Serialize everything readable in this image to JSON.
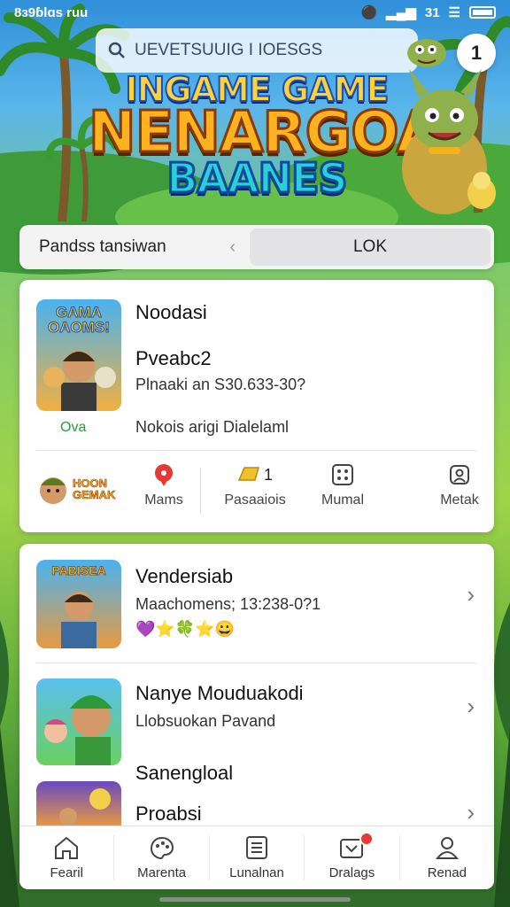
{
  "status": {
    "time": "8ɜ9ɓlɑs ruu",
    "right": "31"
  },
  "search": {
    "placeholder": "UEVETSUUIG I IOESGS"
  },
  "profile": {
    "label": "1"
  },
  "logo": {
    "line1": "INGAME GAME",
    "line2": "NENARGOA",
    "line3": "BAANES"
  },
  "tabs": {
    "left": "Pandss tansiwan",
    "right": "LOK"
  },
  "featured": {
    "thumb_text": "GAMA OAOMS!",
    "status": "Ova",
    "title": "Noodasi",
    "subtitle": "Pveabc2",
    "detail": "Plnaaki an S30.633-30?",
    "footer": "Nokois arigi Dialelaml"
  },
  "stats": {
    "badge_text": "HOON GEMAK",
    "items": [
      {
        "label": "Mams",
        "value": ""
      },
      {
        "label": "Pasaaiois",
        "value": "1"
      },
      {
        "label": "Mumal",
        "value": ""
      },
      {
        "label": "Metak",
        "value": ""
      }
    ]
  },
  "list": [
    {
      "title": "Vendersiab",
      "subtitle": "Maachomens; 13:238-0?1",
      "thumb_text": "PABISEA"
    },
    {
      "title": "Nanye Mouduakodi",
      "subtitle": "Llobsuokan Pavand"
    },
    {
      "title": "Sanengloal",
      "subtitle": "Proabsi"
    }
  ],
  "nav": [
    {
      "label": "Fearil"
    },
    {
      "label": "Marenta"
    },
    {
      "label": "Lunalnan"
    },
    {
      "label": "Dralags"
    },
    {
      "label": "Renad"
    }
  ],
  "colors": {
    "accent_green": "#2a9a3b",
    "badge_red": "#e53935",
    "logo_orange": "#ffb21f"
  }
}
